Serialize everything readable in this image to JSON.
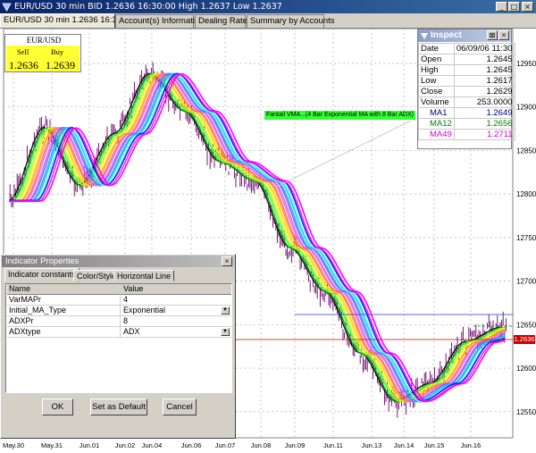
{
  "window": {
    "title": "EUR/USD 30 min BID 1.2636 16:30:00 High 1.2637 Low 1.2637",
    "tabs": [
      "EUR/USD 30 min 1.2636 16:30:00",
      "Account(s) Information",
      "Dealing Rates",
      "Summary by Accounts"
    ],
    "controls": [
      "_",
      "□",
      "×"
    ]
  },
  "quote": {
    "pair": "EUR/USD",
    "sell_label": "Sell",
    "buy_label": "Buy",
    "sell": "1.2636",
    "buy": "1.2639"
  },
  "inspect": {
    "title": "Inspect",
    "rows": [
      {
        "label": "Date",
        "value": "06/09/06 11:30"
      },
      {
        "label": "Open",
        "value": "1.2645"
      },
      {
        "label": "High",
        "value": "1.2645"
      },
      {
        "label": "Low",
        "value": "1.2617"
      },
      {
        "label": "Close",
        "value": "1.2629"
      },
      {
        "label": "Volume",
        "value": "253.0000"
      },
      {
        "label": "MA1",
        "value": "1.2649"
      },
      {
        "label": "MA12",
        "value": "1.2656"
      },
      {
        "label": "MA49",
        "value": "1.2711"
      }
    ],
    "colors": {
      "MA1": "#000080",
      "MA12": "#008000",
      "MA49": "#e000e0"
    }
  },
  "annotation": {
    "text": "Fantail VMA...(4 Bar Exponential MA with 8 Bar ADX)"
  },
  "price_label": {
    "value": "1.2636"
  },
  "chart_data": {
    "type": "line",
    "title": "",
    "xlabel": "",
    "ylabel": "",
    "y_ticks": [
      "12950",
      "12900",
      "12850",
      "12800",
      "12750",
      "12700",
      "12650",
      "12600",
      "12550"
    ],
    "x_ticks": [
      "May.30",
      "May.31",
      "Jun.01",
      "Jun.02",
      "Jun.04",
      "Jun.06",
      "Jun.07",
      "Jun.08",
      "Jun.09",
      "Jun.11",
      "Jun.13",
      "Jun.14",
      "Jun.15",
      "Jun.16"
    ],
    "ylim": [
      12520,
      12990
    ],
    "series": [
      {
        "values": [
          12792,
          12876,
          12810,
          12869,
          12938,
          12895,
          12837,
          12815,
          12738,
          12688,
          12617,
          12562,
          12582,
          12630,
          12646
        ]
      }
    ]
  },
  "dialog": {
    "title": "Indicator Properties",
    "tabs": [
      "Indicator constants",
      "Color/Style",
      "Horizontal Line"
    ],
    "header": {
      "name": "Name",
      "value": "Value"
    },
    "rows": [
      {
        "name": "VarMAPr",
        "value": "4",
        "dropdown": false
      },
      {
        "name": "Initial_MA_Type",
        "value": "Exponential",
        "dropdown": true
      },
      {
        "name": "ADXPr",
        "value": "8",
        "dropdown": false
      },
      {
        "name": "ADXtype",
        "value": "ADX",
        "dropdown": true
      }
    ],
    "buttons": {
      "ok": "OK",
      "default": "Set as Default",
      "cancel": "Cancel"
    }
  }
}
